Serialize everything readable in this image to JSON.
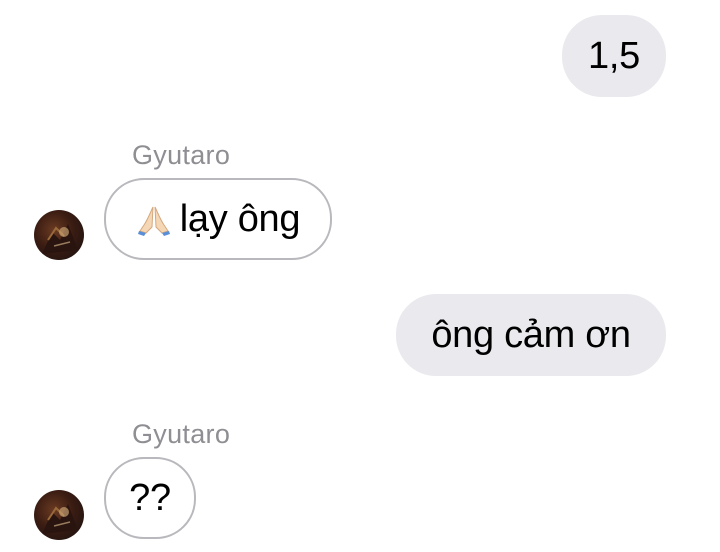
{
  "messages": [
    {
      "direction": "outgoing",
      "text": "1,5"
    },
    {
      "direction": "incoming",
      "sender": "Gyutaro",
      "emoji": "folded-hands",
      "text": "lạy ông"
    },
    {
      "direction": "outgoing",
      "text": "ông cảm ơn"
    },
    {
      "direction": "incoming",
      "sender": "Gyutaro",
      "text": "??"
    }
  ],
  "colors": {
    "outgoing_bubble": "#e9e9ee",
    "incoming_border": "#b8b8bd",
    "sender_name": "#8e8e93"
  }
}
